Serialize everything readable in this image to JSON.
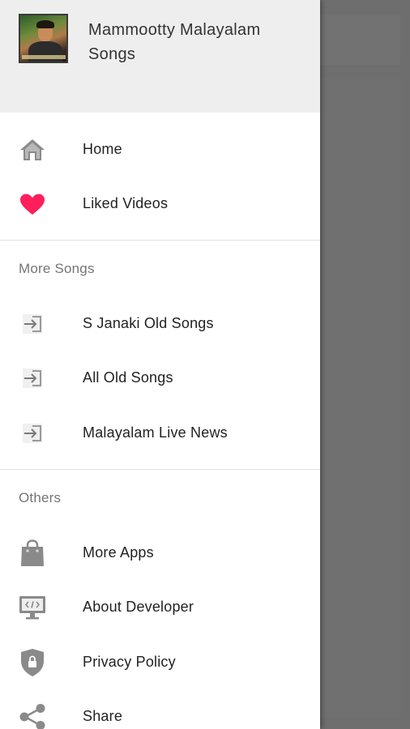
{
  "header": {
    "app_title": "Mammootty Malayalam Songs"
  },
  "primary_nav": [
    {
      "label": "Home",
      "icon": "home-icon"
    },
    {
      "label": "Liked Videos",
      "icon": "heart-icon"
    }
  ],
  "more_songs": {
    "title": "More Songs",
    "items": [
      {
        "label": "S Janaki Old Songs",
        "icon": "open-link-icon"
      },
      {
        "label": "All Old Songs",
        "icon": "open-link-icon"
      },
      {
        "label": "Malayalam Live News",
        "icon": "open-link-icon"
      }
    ]
  },
  "others": {
    "title": "Others",
    "items": [
      {
        "label": "More Apps",
        "icon": "shopping-bag-icon"
      },
      {
        "label": "About Developer",
        "icon": "monitor-code-icon"
      },
      {
        "label": "Privacy Policy",
        "icon": "shield-lock-icon"
      },
      {
        "label": "Share",
        "icon": "share-icon"
      }
    ]
  },
  "colors": {
    "heart": "#ff1f5a",
    "icon_gray": "#8a8a8a",
    "header_bg": "#eeeeee",
    "scrim": "#6e6e6e"
  }
}
